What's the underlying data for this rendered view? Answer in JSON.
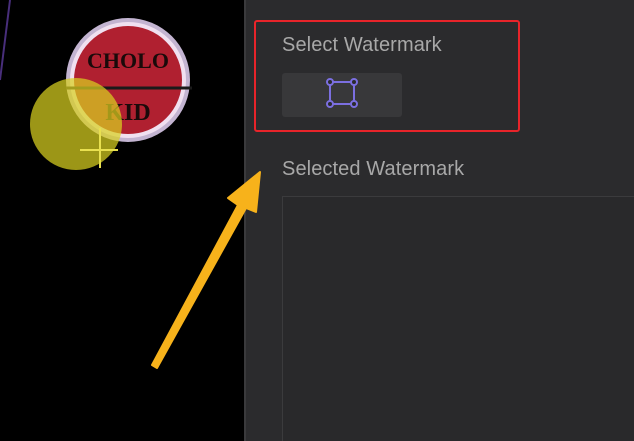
{
  "panel": {
    "select_watermark_label": "Select Watermark",
    "selected_watermark_label": "Selected Watermark",
    "select_tool_icon": "rectangle-select-icon"
  },
  "video": {
    "logo_text_top": "CHOLO",
    "logo_text_bottom": "KID"
  },
  "colors": {
    "panel_bg": "#2b2b2d",
    "highlight_red": "#e8242a",
    "arrow_yellow": "#f7b21b",
    "icon_purple": "#7b6fe0",
    "label_gray": "#a8a8a8"
  }
}
